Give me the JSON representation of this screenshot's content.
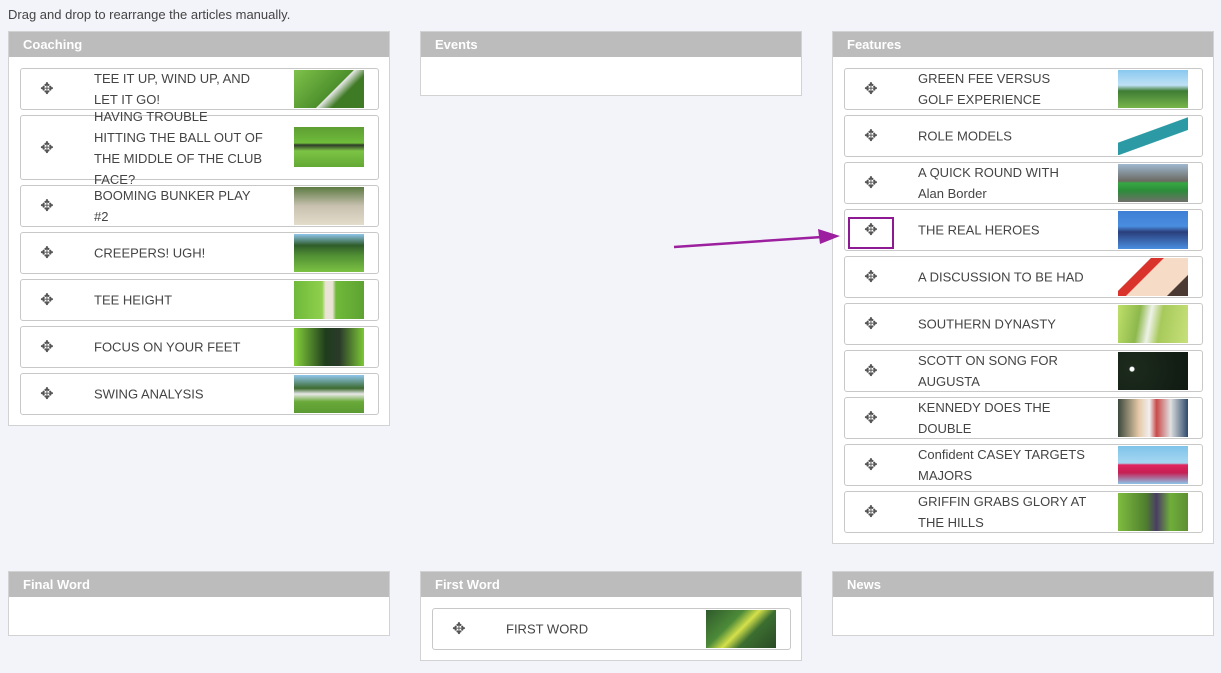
{
  "instruction": "Drag and drop to rearrange the articles manually.",
  "columns": {
    "coaching": {
      "title": "Coaching",
      "items": [
        {
          "title": "TEE IT UP, WIND UP, AND LET IT GO!"
        },
        {
          "title": "HAVING TROUBLE HITTING THE BALL OUT OF THE MIDDLE OF THE CLUB FACE?"
        },
        {
          "title": "BOOMING BUNKER PLAY #2"
        },
        {
          "title": "CREEPERS! UGH!"
        },
        {
          "title": "TEE HEIGHT"
        },
        {
          "title": "FOCUS ON YOUR FEET"
        },
        {
          "title": "SWING ANALYSIS"
        }
      ]
    },
    "events": {
      "title": "Events",
      "items": []
    },
    "features": {
      "title": "Features",
      "items": [
        {
          "title": "GREEN FEE VERSUS GOLF EXPERIENCE"
        },
        {
          "title": "ROLE MODELS"
        },
        {
          "title": "A QUICK ROUND WITH Alan Border"
        },
        {
          "title": "THE REAL HEROES"
        },
        {
          "title": "A DISCUSSION TO BE HAD"
        },
        {
          "title": "SOUTHERN DYNASTY"
        },
        {
          "title": "SCOTT ON SONG FOR AUGUSTA"
        },
        {
          "title": "KENNEDY DOES THE DOUBLE"
        },
        {
          "title": "Confident CASEY TARGETS MAJORS"
        },
        {
          "title": "GRIFFIN GRABS GLORY AT THE HILLS"
        }
      ]
    },
    "final_word": {
      "title": "Final Word",
      "items": []
    },
    "first_word": {
      "title": "First Word",
      "items": [
        {
          "title": "FIRST WORD"
        }
      ]
    },
    "news": {
      "title": "News",
      "items": []
    }
  },
  "icons": {
    "drag_handle": "move-arrows-icon",
    "thumbnail": "article-thumbnail"
  },
  "colors": {
    "header_bg": "#bcbcbc",
    "highlight": "#8e1a93",
    "arrow": "#9b1f9e"
  }
}
